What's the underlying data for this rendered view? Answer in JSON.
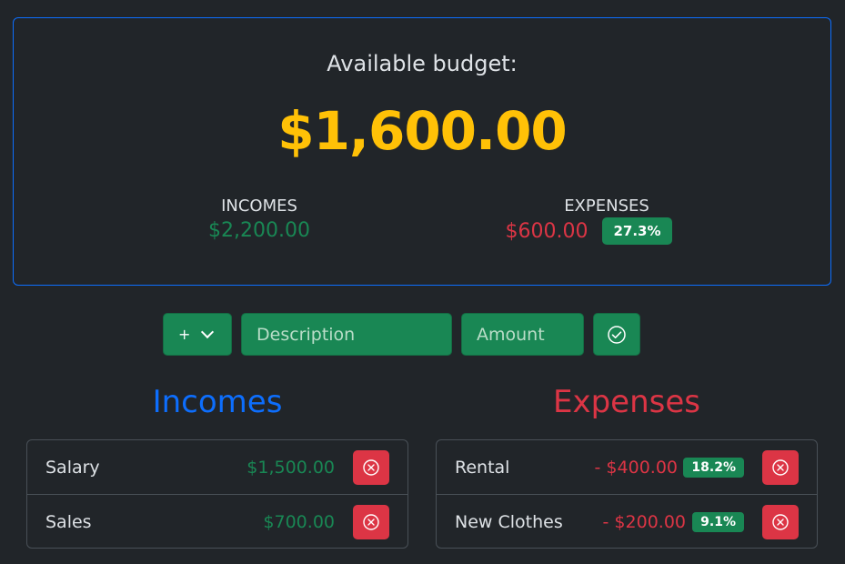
{
  "summary": {
    "title": "Available budget:",
    "amount": "$1,600.00",
    "incomes_label": "INCOMES",
    "incomes_value": "$2,200.00",
    "expenses_label": "EXPENSES",
    "expenses_value": "$600.00",
    "expenses_percent": "27.3%"
  },
  "form": {
    "type_value": "+",
    "description_placeholder": "Description",
    "amount_placeholder": "Amount"
  },
  "incomes": {
    "heading": "Incomes",
    "items": [
      {
        "description": "Salary",
        "amount": "$1,500.00"
      },
      {
        "description": "Sales",
        "amount": "$700.00"
      }
    ]
  },
  "expenses": {
    "heading": "Expenses",
    "items": [
      {
        "description": "Rental",
        "amount": "- $400.00",
        "percent": "18.2%"
      },
      {
        "description": "New Clothes",
        "amount": "- $200.00",
        "percent": "9.1%"
      }
    ]
  },
  "colors": {
    "success": "#198754",
    "danger": "#dc3545",
    "warning": "#ffc107",
    "primary": "#0d6efd"
  }
}
